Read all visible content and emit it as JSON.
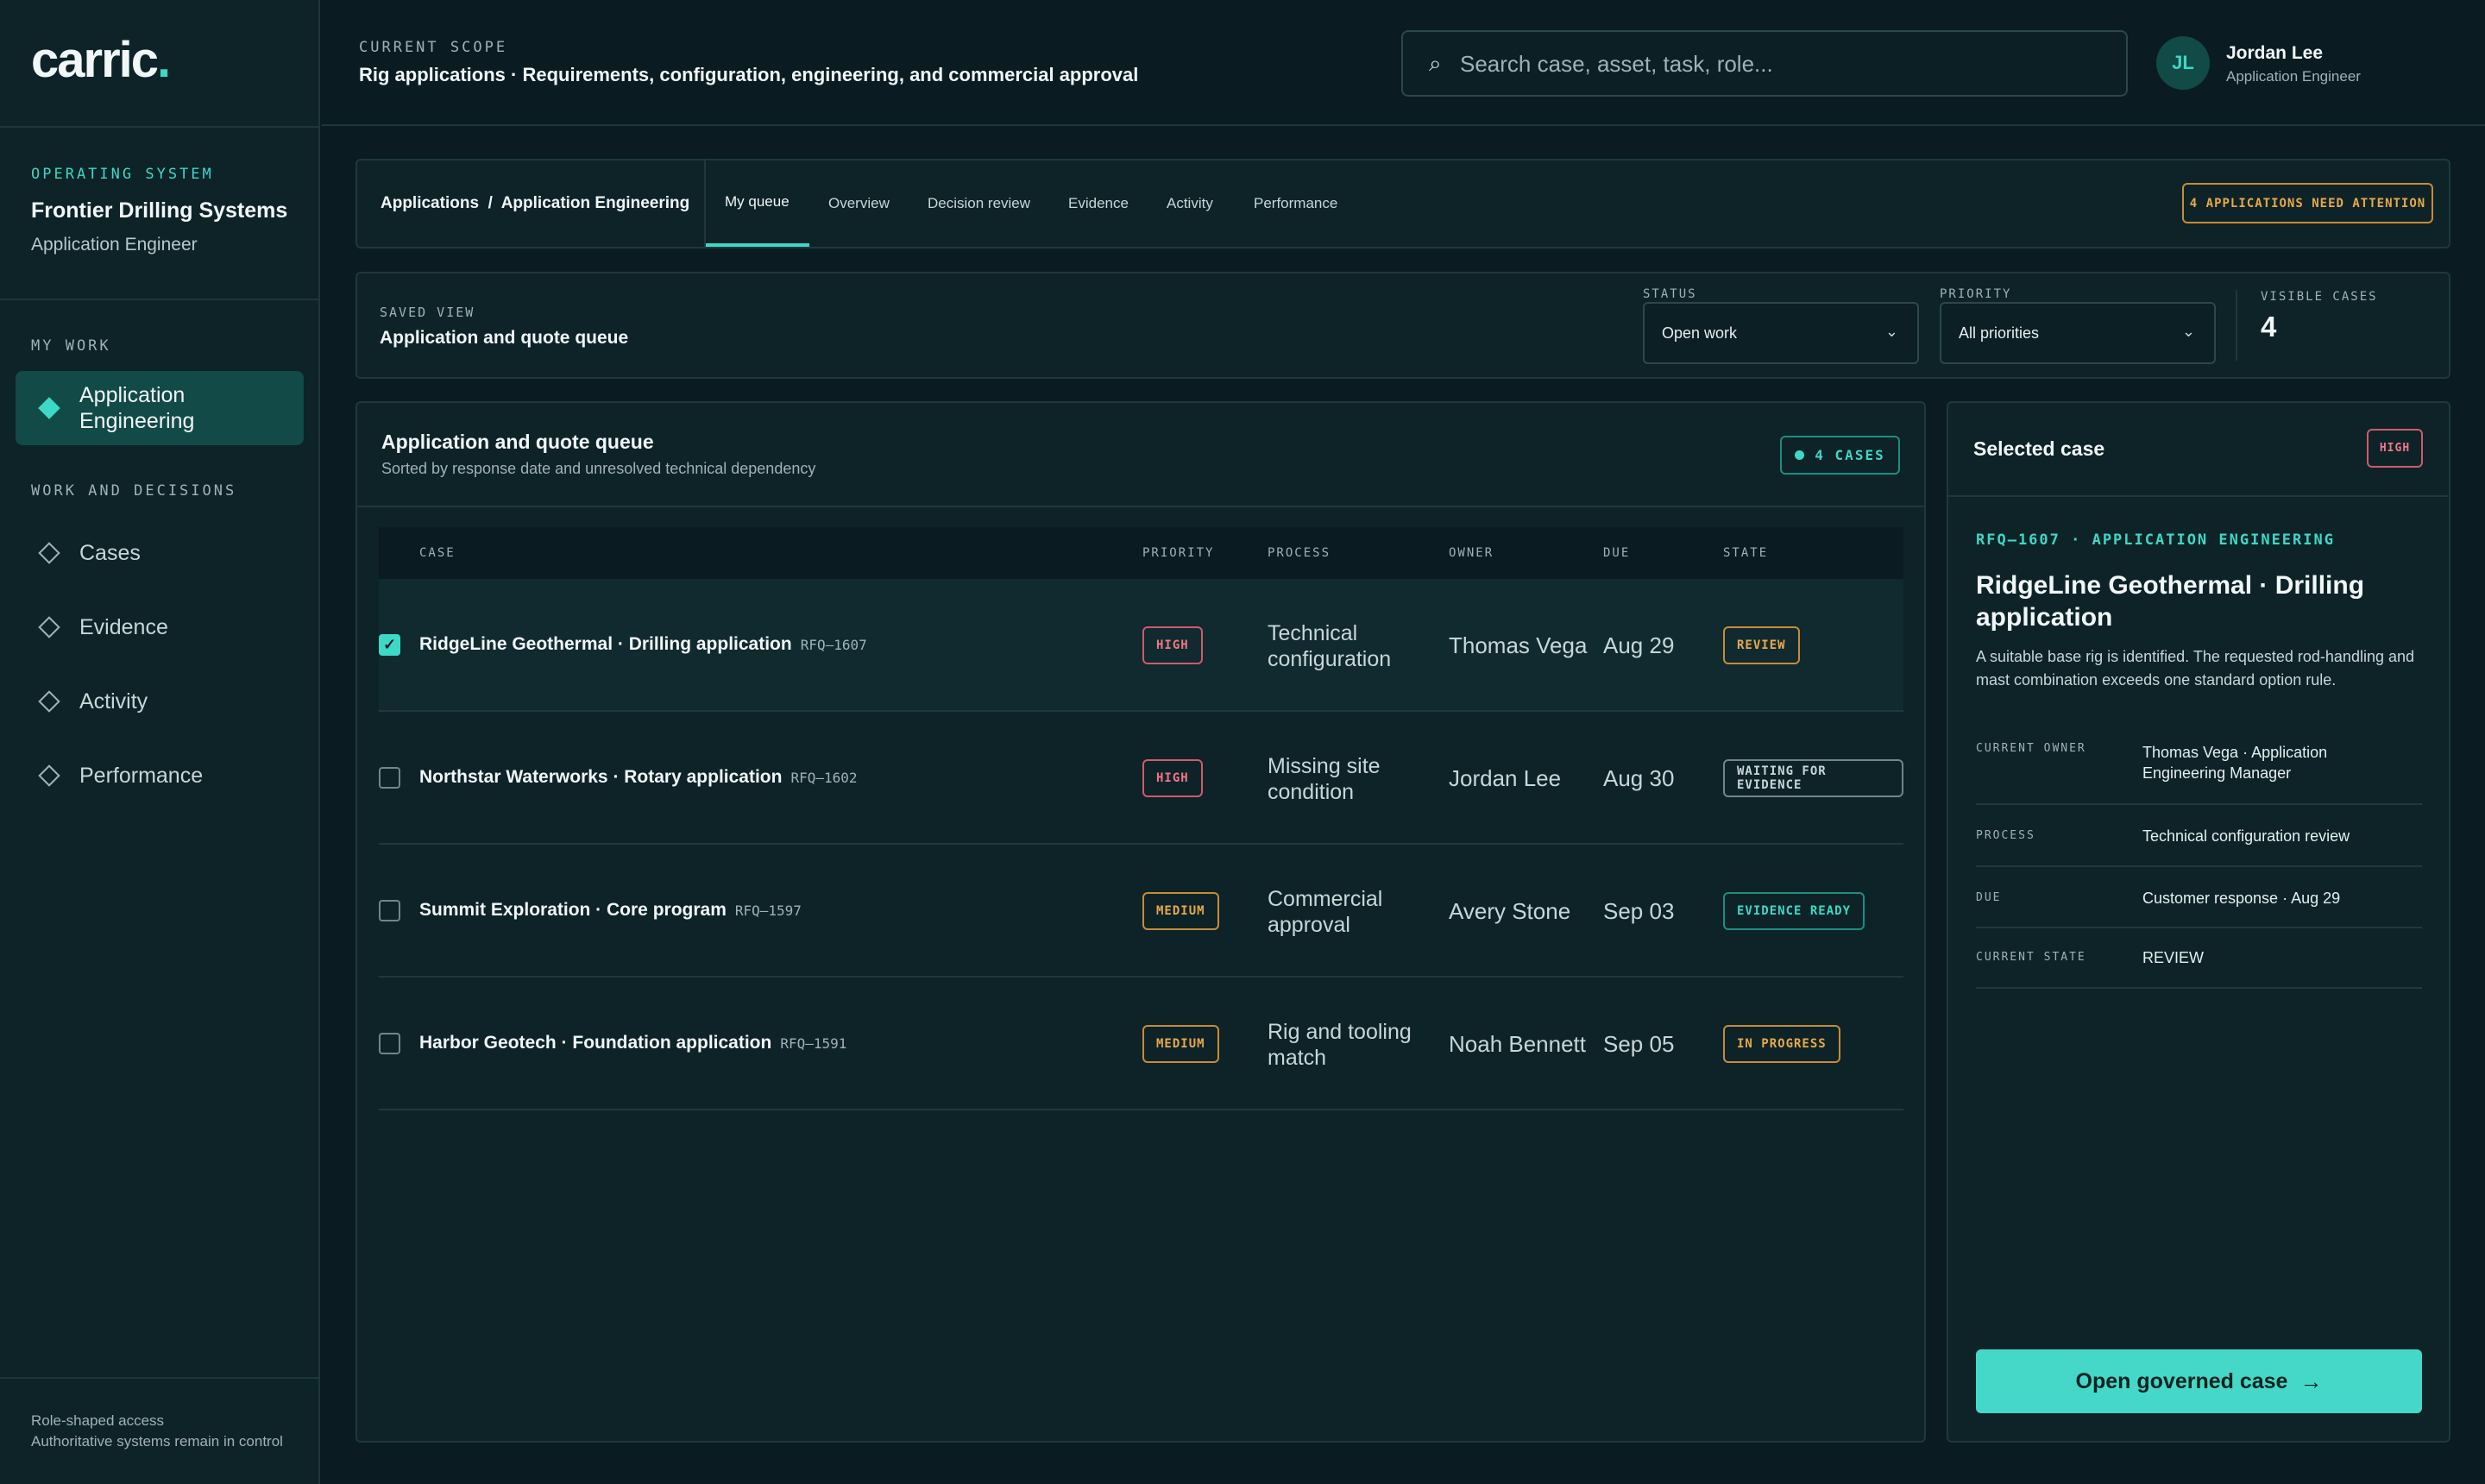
{
  "sidebar": {
    "logo_text": "carric",
    "logo_dot": ".",
    "org_eyebrow": "OPERATING SYSTEM",
    "org_name": "Frontier Drilling Systems",
    "org_role": "Application Engineer",
    "my_work_label": "MY WORK",
    "active_item": {
      "label": "Application Engineering",
      "icon": "diamond-filled-icon"
    },
    "section_label": "WORK AND DECISIONS",
    "items": [
      {
        "label": "Cases",
        "icon": "diamond-outline-icon"
      },
      {
        "label": "Evidence",
        "icon": "diamond-outline-icon"
      },
      {
        "label": "Activity",
        "icon": "diamond-outline-icon"
      },
      {
        "label": "Performance",
        "icon": "diamond-outline-icon"
      }
    ],
    "footer_line1": "Role-shaped access",
    "footer_line2": "Authoritative systems remain in control"
  },
  "header": {
    "scope_eyebrow": "CURRENT SCOPE",
    "scope_title": "Rig applications · Requirements, configuration, engineering, and commercial approval",
    "search_placeholder": "Search case, asset, task, role...",
    "search_icon": "⌕",
    "user_initials": "JL",
    "user_name": "Jordan Lee",
    "user_role": "Application Engineer"
  },
  "nav": {
    "breadcrumb": "Applications  /  Application Engineering",
    "tabs": [
      "My queue",
      "Overview",
      "Decision review",
      "Evidence",
      "Activity",
      "Performance"
    ],
    "active_tab": "My queue",
    "attention_badge": "4 APPLICATIONS NEED ATTENTION"
  },
  "saved_view": {
    "eyebrow": "SAVED VIEW",
    "title": "Application and quote queue",
    "status_label": "STATUS",
    "status_value": "Open work",
    "priority_label": "PRIORITY",
    "priority_value": "All priorities",
    "chevron": "⌄",
    "visible_label": "VISIBLE CASES",
    "visible_value": "4"
  },
  "queue": {
    "title": "Application and quote queue",
    "subtitle": "Sorted by response date and unresolved technical dependency",
    "count_badge": "4 CASES",
    "columns": [
      "CASE",
      "PRIORITY",
      "PROCESS",
      "OWNER",
      "DUE",
      "STATE"
    ],
    "rows": [
      {
        "checked": true,
        "name": "RidgeLine Geothermal · Drilling application",
        "id": "RFQ–1607",
        "priority": "HIGH",
        "process": "Technical configuration",
        "owner": "Thomas Vega",
        "due": "Aug 29",
        "state": "REVIEW"
      },
      {
        "checked": false,
        "name": "Northstar Waterworks · Rotary application",
        "id": "RFQ–1602",
        "priority": "HIGH",
        "process": "Missing site condition",
        "owner": "Jordan Lee",
        "due": "Aug 30",
        "state": "WAITING FOR EVIDENCE"
      },
      {
        "checked": false,
        "name": "Summit Exploration · Core program",
        "id": "RFQ–1597",
        "priority": "MEDIUM",
        "process": "Commercial approval",
        "owner": "Avery Stone",
        "due": "Sep 03",
        "state": "EVIDENCE READY"
      },
      {
        "checked": false,
        "name": "Harbor Geotech · Foundation application",
        "id": "RFQ–1591",
        "priority": "MEDIUM",
        "process": "Rig and tooling match",
        "owner": "Noah Bennett",
        "due": "Sep 05",
        "state": "IN PROGRESS"
      }
    ],
    "check_mark": "✓"
  },
  "colors": {
    "accent": "#3ed8c6",
    "high": "#f07787",
    "medium": "#e8a94a",
    "neutral": "#c8d6d8"
  },
  "selected_case": {
    "title": "Selected case",
    "priority": "HIGH",
    "eyebrow": "RFQ–1607 · APPLICATION ENGINEERING",
    "name": "RidgeLine Geothermal · Drilling application",
    "description": "A suitable base rig is identified. The requested rod-handling and mast combination exceeds one standard option rule.",
    "details": [
      {
        "label": "CURRENT OWNER",
        "value": "Thomas Vega · Application Engineering Manager"
      },
      {
        "label": "PROCESS",
        "value": "Technical configuration review"
      },
      {
        "label": "DUE",
        "value": "Customer response · Aug 29"
      },
      {
        "label": "CURRENT STATE",
        "value": "REVIEW"
      }
    ],
    "button_label": "Open governed case",
    "button_arrow": "→"
  }
}
